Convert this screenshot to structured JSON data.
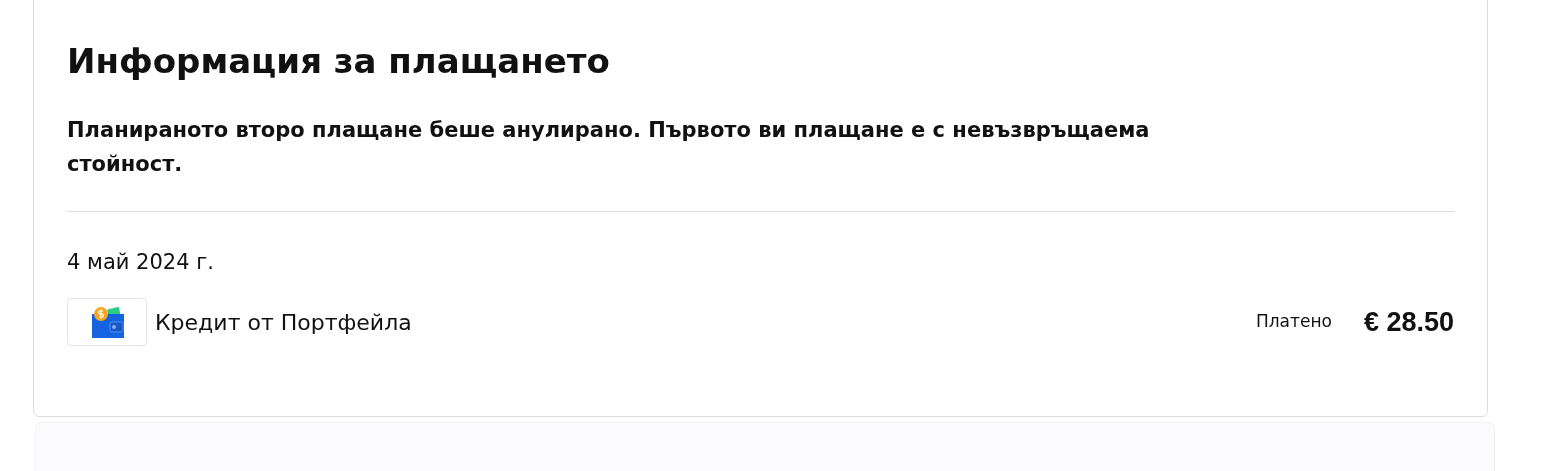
{
  "card": {
    "title": "Информация за плащането",
    "notice": "Планираното второ плащане беше анулирано. Първото ви плащане е с невъзвръщаема стойност.",
    "date": "4 май 2024 г.",
    "payments": [
      {
        "method": "Кредит от Портфейла",
        "status": "Платено",
        "amount": "€ 28.50"
      }
    ]
  }
}
